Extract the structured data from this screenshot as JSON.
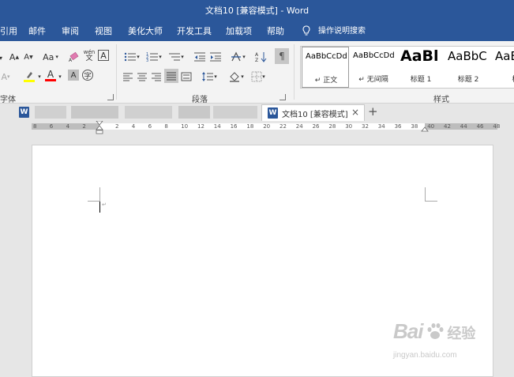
{
  "window": {
    "title": "文档10 [兼容模式] - Word"
  },
  "menu": {
    "tabs": [
      "引用",
      "邮件",
      "审阅",
      "视图",
      "美化大师",
      "开发工具",
      "加载项",
      "帮助"
    ],
    "tell_me": "操作说明搜索"
  },
  "ribbon": {
    "groups": {
      "font": "字体",
      "paragraph": "段落",
      "styles": "样式"
    },
    "font_buttons": {
      "case": "Aa",
      "grow": "A",
      "shrink": "A",
      "wen": "wén",
      "char_border": "A"
    },
    "styles": [
      {
        "preview": "AaBbCcDd",
        "name": "正文"
      },
      {
        "preview": "AaBbCcDd",
        "name": "无间隔"
      },
      {
        "preview": "AaBl",
        "name": "标题 1"
      },
      {
        "preview": "AaBbC",
        "name": "标题 2"
      },
      {
        "preview": "AaB",
        "name": "标"
      }
    ]
  },
  "doc_tabs": {
    "active": "文档10 [兼容模式]",
    "new_tab": "+",
    "close": "×"
  },
  "ruler": {
    "labels": [
      "8",
      "6",
      "4",
      "2",
      "2",
      "4",
      "6",
      "8",
      "10",
      "12",
      "14",
      "16",
      "18",
      "20",
      "22",
      "24",
      "26",
      "28",
      "30",
      "32",
      "34",
      "36",
      "38",
      "40",
      "42",
      "44",
      "46",
      "48"
    ]
  },
  "watermark": {
    "brand": "Bai",
    "brand2": "经验",
    "url": "jingyan.baidu.com"
  },
  "colors": {
    "accent": "#2b579a",
    "highlight": "#ffff00",
    "font_color": "#ff0000"
  }
}
